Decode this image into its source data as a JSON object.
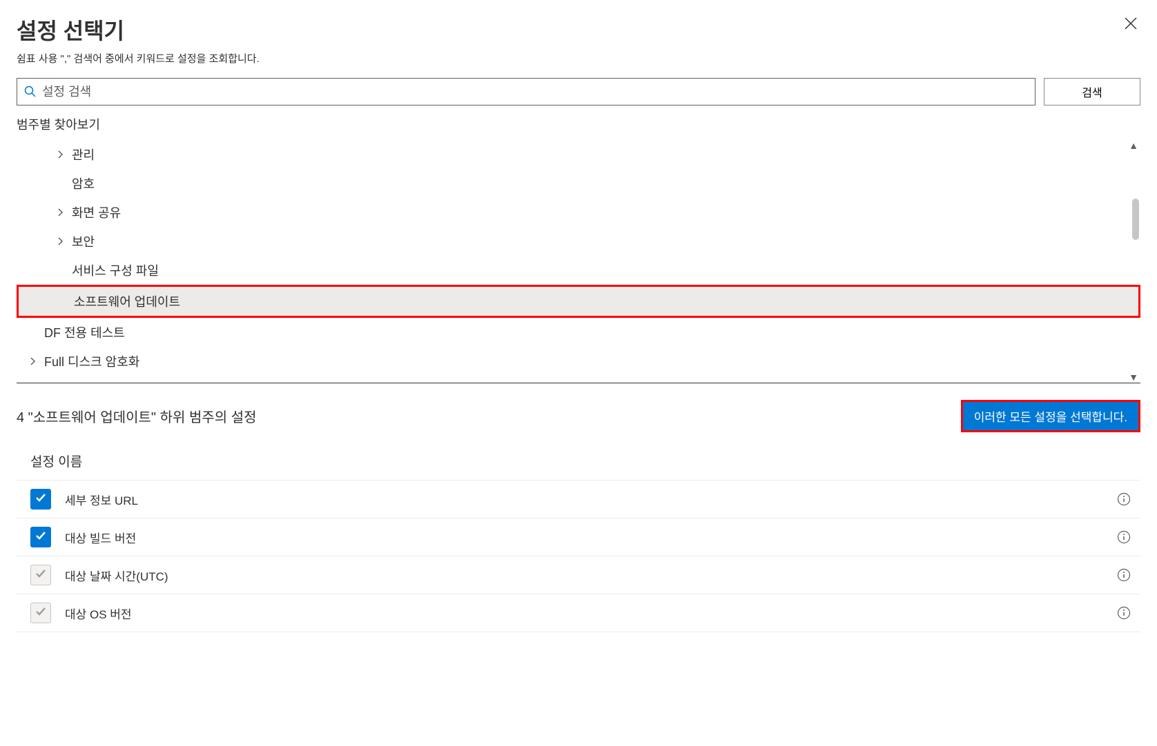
{
  "header": {
    "title": "설정 선택기",
    "subtitle": "쉼표 사용      \",\" 검색어 중에서 키워드로 설정을 조회합니다."
  },
  "search": {
    "placeholder": "설정 검색",
    "button_label": "검색"
  },
  "browse_label": "범주별 찾아보기",
  "tree": {
    "items": [
      {
        "label": "관리",
        "has_chevron": true,
        "indented": true
      },
      {
        "label": "암호",
        "has_chevron": false,
        "indented": true
      },
      {
        "label": "화면 공유",
        "has_chevron": true,
        "indented": true
      },
      {
        "label": "보안",
        "has_chevron": true,
        "indented": true
      },
      {
        "label": "서비스 구성 파일",
        "has_chevron": false,
        "indented": true
      },
      {
        "label": "소프트웨어 업데이트",
        "has_chevron": false,
        "indented": true,
        "selected": true
      },
      {
        "label": "DF 전용 테스트",
        "has_chevron": false,
        "indented": false
      },
      {
        "label": "Full  디스크 암호화",
        "has_chevron": true,
        "indented": false
      }
    ]
  },
  "settings": {
    "count_text": "4 \"소프트웨어 업데이트\" 하위 범주의 설정",
    "select_all_label": "이러한 모든 설정을 선택합니다.",
    "column_header": "설정 이름",
    "rows": [
      {
        "label": "세부 정보 URL",
        "checked": true,
        "disabled": false
      },
      {
        "label": "대상 빌드 버전",
        "checked": true,
        "disabled": false
      },
      {
        "label": "대상 날짜 시간(UTC)",
        "checked": true,
        "disabled": true
      },
      {
        "label": "대상 OS 버전",
        "checked": true,
        "disabled": true
      }
    ]
  }
}
